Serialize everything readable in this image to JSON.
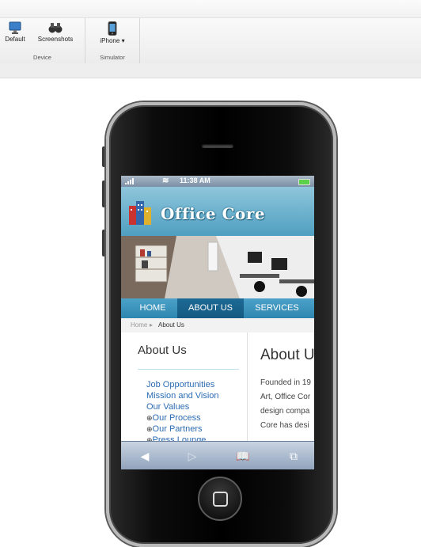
{
  "ribbon": {
    "device_group": {
      "label": "Device",
      "default_label": "Default",
      "screenshots_label": "Screenshots"
    },
    "simulator_group": {
      "label": "Simulator",
      "iphone_label": "iPhone"
    }
  },
  "status_bar": {
    "time": "11:38 AM"
  },
  "site": {
    "logo_text": "Office Core",
    "nav": [
      "HOME",
      "ABOUT US",
      "SERVICES"
    ],
    "breadcrumb": {
      "home": "Home",
      "current": "About Us"
    },
    "sidebar": {
      "title": "About Us",
      "links": [
        "Job Opportunities",
        "Mission and Vision",
        "Our Values",
        "Our Process",
        "Our Partners",
        "Press Lounge"
      ]
    },
    "main": {
      "title": "About Us",
      "paragraph_lines": [
        "Founded in 19",
        "Art, Office Cor",
        "design compa",
        "Core has desi"
      ]
    }
  },
  "colors": {
    "nav": "#2d86b0",
    "nav_active": "#145a82",
    "link": "#2b6bb3",
    "header": "#4f9fc1"
  }
}
